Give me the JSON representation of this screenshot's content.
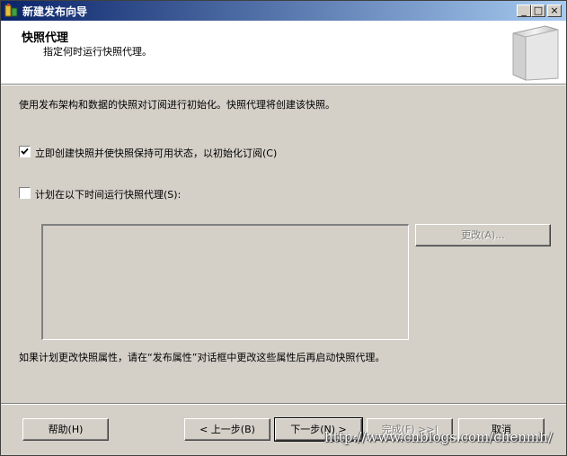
{
  "window": {
    "title": "新建发布向导",
    "caption_buttons": {
      "minimize": "_",
      "maximize": "□",
      "close": "×"
    }
  },
  "header": {
    "title": "快照代理",
    "subtitle": "指定何时运行快照代理。"
  },
  "main": {
    "description": "使用发布架构和数据的快照对订阅进行初始化。快照代理将创建该快照。",
    "options": [
      {
        "label": "立即创建快照并使快照保持可用状态，以初始化订阅(C)",
        "checked": true
      },
      {
        "label": "计划在以下时间运行快照代理(S):",
        "checked": false
      }
    ],
    "change_button": "更改(A)...",
    "note": "如果计划更改快照属性，请在“发布属性”对话框中更改这些属性后再启动快照代理。"
  },
  "footer": {
    "help": "帮助(H)",
    "back": "< 上一步(B)",
    "next": "下一步(N) >",
    "finish": "完成(F) >>|",
    "cancel": "取消"
  },
  "watermark": "http://www.cnblogs.com/chenmh/"
}
